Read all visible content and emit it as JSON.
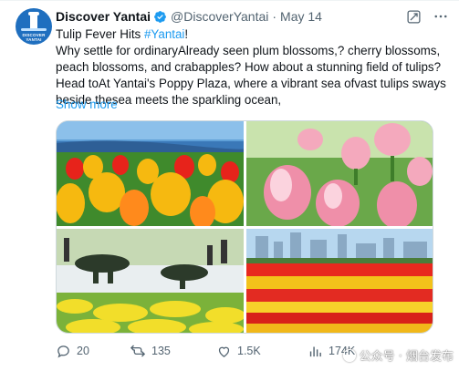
{
  "tweet": {
    "avatar_text": "DISCOVER YANTAI",
    "display_name": "Discover Yantai",
    "handle": "@DiscoverYantai",
    "separator": "·",
    "date": "May 14",
    "lines": [
      "Tulip Fever Hits ",
      "Why settle for ordinaryAlready seen plum blossoms,? cherry blossoms,",
      "peach blossoms, and crabapples? How about a stunning field of tulips?",
      "Head toAt Yantai's Poppy Plaza, where a vibrant sea ofvast tulips sways",
      "beside thesea meets the sparkling ocean,"
    ],
    "hashtag": "#Yantai",
    "hashtag_suffix": "!",
    "show_more": "Show more",
    "colors": {
      "accent": "#1d9bf0",
      "verified": "#1d9bf0",
      "muted": "#536471"
    }
  },
  "media": {
    "images": [
      {
        "icon": "tulip-photo-red-yellow-waterfront"
      },
      {
        "icon": "tulip-photo-pink-closeup"
      },
      {
        "icon": "tulip-photo-plaza-sculpture"
      },
      {
        "icon": "tulip-photo-red-yellow-field-city"
      }
    ]
  },
  "actions": {
    "reply_count": "20",
    "retweet_count": "135",
    "like_count": "1.5K",
    "views_count": "174K"
  },
  "watermark": {
    "text": "公众号 · 烟台发布"
  }
}
